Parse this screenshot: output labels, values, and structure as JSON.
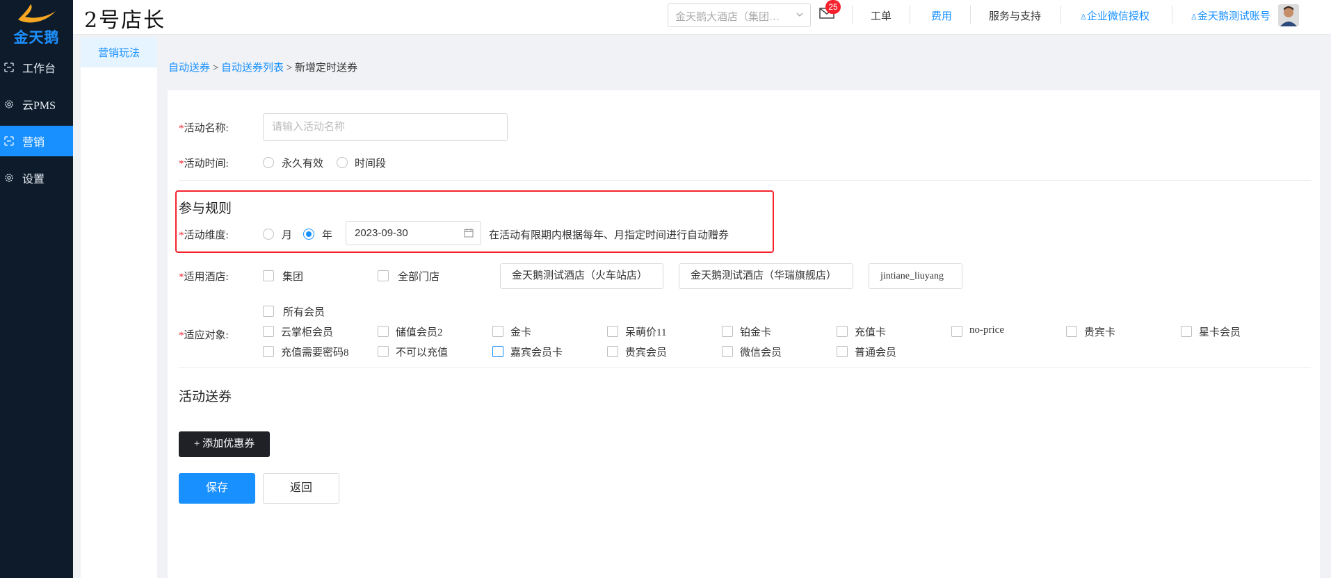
{
  "brand": {
    "name": "金天鹅"
  },
  "sidebar": {
    "items": [
      {
        "label": "工作台",
        "icon": "dashboard-icon"
      },
      {
        "label": "云PMS",
        "icon": "gear-icon"
      },
      {
        "label": "营销",
        "icon": "marketing-icon",
        "active": true
      },
      {
        "label": "设置",
        "icon": "gear-icon"
      }
    ]
  },
  "header": {
    "title": "2号店长",
    "hotel_select": "金天鹅大酒店（集团…",
    "mail_badge": "25",
    "links": {
      "workorder": "工单",
      "fees": "费用",
      "support": "服务与支持",
      "wechat_auth": "企业微信授权",
      "account": "金天鹅测试账号"
    }
  },
  "subnav": {
    "items": [
      {
        "label": "营销玩法"
      }
    ]
  },
  "breadcrumb": {
    "items": [
      "自动送券",
      "自动送券列表"
    ],
    "current": "新增定时送券",
    "sep": ">"
  },
  "form": {
    "activity_name": {
      "label": "活动名称:",
      "placeholder": "请输入活动名称",
      "value": ""
    },
    "activity_time": {
      "label": "活动时间:",
      "options": [
        "永久有效",
        "时间段"
      ]
    },
    "rules": {
      "title": "参与规则",
      "dimension_label": "活动维度:",
      "options": [
        "月",
        "年"
      ],
      "selected": "年",
      "date": "2023-09-30",
      "hint": "在活动有限期内根据每年、月指定时间进行自动赠券"
    },
    "hotels": {
      "label": "适用酒店:",
      "checkboxes": [
        "集团",
        "全部门店"
      ],
      "tags": [
        "金天鹅测试酒店（火车站店）",
        "金天鹅测试酒店（华瑞旗舰店）",
        "jintiane_liuyang"
      ]
    },
    "targets": {
      "label": "适应对象:",
      "all": "所有会员",
      "row1": [
        "云掌柜会员",
        "储值会员2",
        "金卡",
        "呆萌价11",
        "铂金卡",
        "充值卡",
        "no-price",
        "贵宾卡",
        "星卡会员"
      ],
      "row2": [
        "充值需要密码8",
        "不可以充值",
        "嘉宾会员卡",
        "贵宾会员",
        "微信会员",
        "普通会员"
      ]
    },
    "coupons": {
      "title": "活动送券",
      "add_button": "+ 添加优惠券"
    },
    "actions": {
      "save": "保存",
      "back": "返回"
    }
  }
}
